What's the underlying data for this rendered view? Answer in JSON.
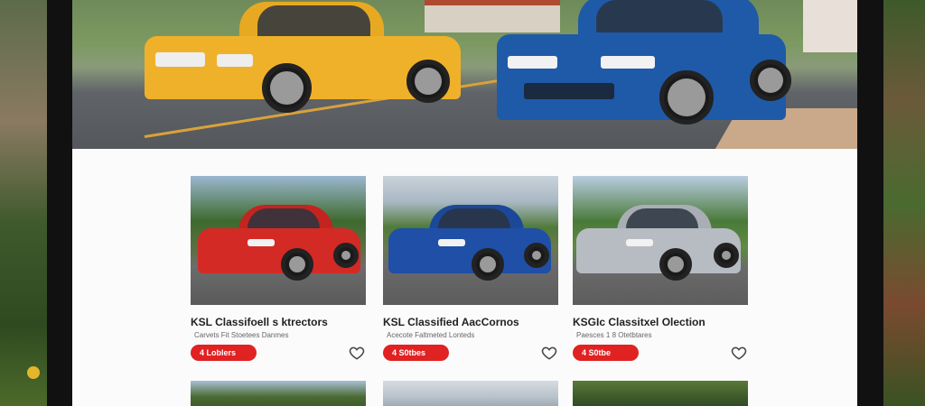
{
  "colors": {
    "price_badge": "#e02222",
    "card_1_car": "#d42a25",
    "card_2_car": "#1f4fa6",
    "card_3_car": "#b7bcc2",
    "hero_left_car": "#f0b12a",
    "hero_right_car": "#1f5aa8"
  },
  "listings": [
    {
      "title": "KSL Classifoell s ktrectors",
      "subtitle": "Carvets Fit Stoetees Danmes",
      "price": "4 Loblers",
      "heart_icon": "heart-outline"
    },
    {
      "title": "KSL Classified AacCornos",
      "subtitle": "Acecote Faltmeted Lonteds",
      "price": "4 S0tbes",
      "heart_icon": "heart-outline"
    },
    {
      "title": "KSGIc Classitxel Olection",
      "subtitle": "Paesces 1 8 Otetbtares",
      "price": "4 S0tbe",
      "heart_icon": "heart-outline"
    }
  ]
}
